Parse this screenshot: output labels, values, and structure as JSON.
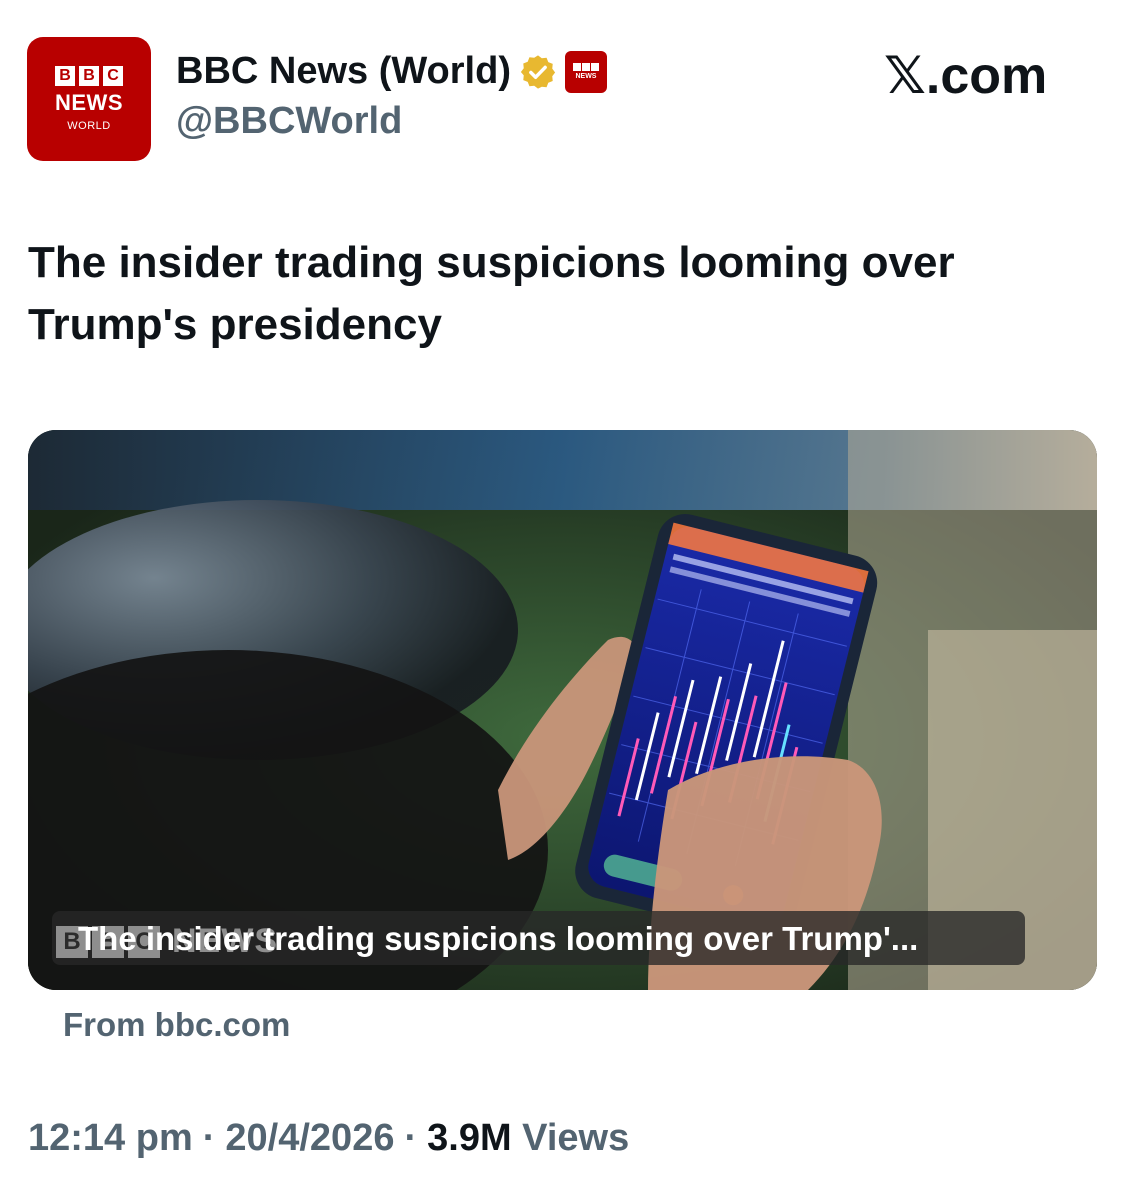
{
  "author": {
    "avatar": {
      "blocks": [
        "B",
        "B",
        "C"
      ],
      "line1": "NEWS",
      "line2": "WORLD"
    },
    "display_name": "BBC News (World)",
    "handle": "@BBCWorld",
    "verified_icon": "gold-check-badge-icon",
    "affiliate_badge": {
      "blocks": [
        "B",
        "B",
        "C"
      ],
      "label": "NEWS"
    }
  },
  "site_label": "𝕏.com",
  "post": {
    "text": "The insider trading suspicions looming over Trump's presidency"
  },
  "media": {
    "caption": "The insider trading suspicions looming over Trump'...",
    "watermark": {
      "blocks": [
        "B",
        "B",
        "C"
      ],
      "label": "NEWS"
    },
    "source": "From bbc.com"
  },
  "meta": {
    "time": "12:14 pm",
    "separator": "·",
    "date": "20/4/2026",
    "views_count": "3.9M",
    "views_label": "Views"
  },
  "colors": {
    "bbc_red": "#b80000",
    "text_primary": "#0f1419",
    "text_secondary": "#536471",
    "verified_gold": "#e8b830"
  }
}
